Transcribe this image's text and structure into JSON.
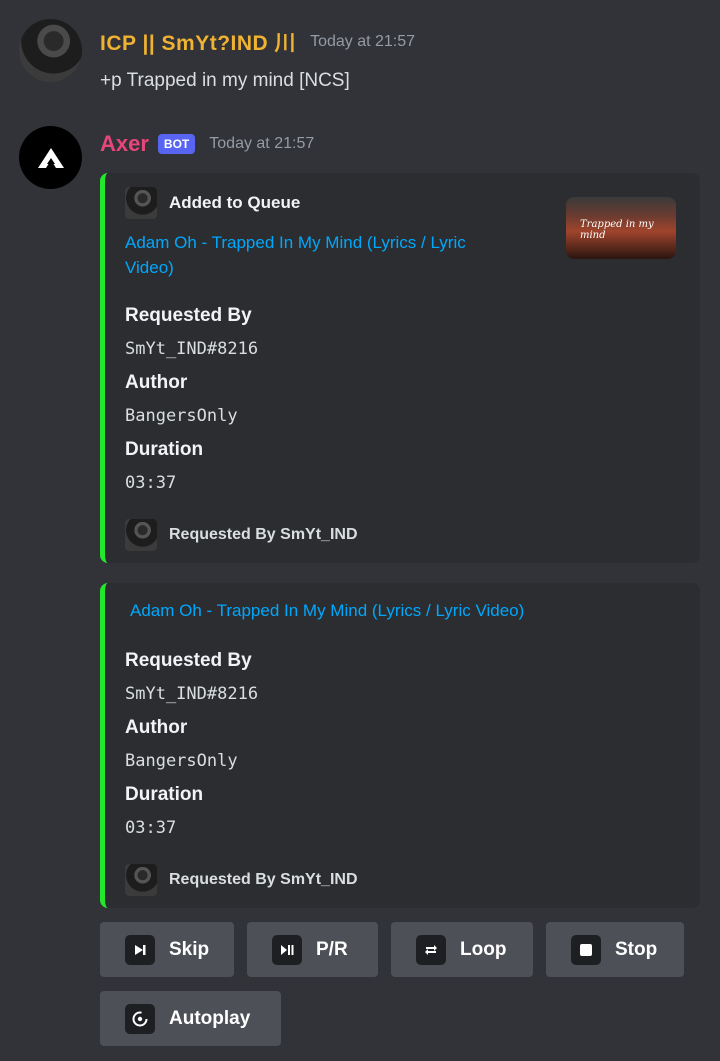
{
  "messages": [
    {
      "username": "ICP || SmYt?IND 川",
      "timestamp": "Today at 21:57",
      "text": "+p Trapped in my mind [NCS]"
    },
    {
      "username": "Axer",
      "badge": "BOT",
      "timestamp": "Today at 21:57"
    }
  ],
  "embeds": [
    {
      "author": "Added to Queue",
      "title": "Adam Oh - Trapped In My Mind (Lyrics / Lyric Video)",
      "thumbnail_text": "Trapped in my mind",
      "fields": [
        {
          "name": "Requested By",
          "value": "SmYt_IND#8216"
        },
        {
          "name": "Author",
          "value": "BangersOnly"
        },
        {
          "name": "Duration",
          "value": "03:37"
        }
      ],
      "footer": "Requested By SmYt_IND",
      "accent": "#23e72a"
    },
    {
      "title": "Adam Oh - Trapped In My Mind (Lyrics / Lyric Video)",
      "fields": [
        {
          "name": "Requested By",
          "value": "SmYt_IND#8216"
        },
        {
          "name": "Author",
          "value": "BangersOnly"
        },
        {
          "name": "Duration",
          "value": "03:37"
        }
      ],
      "footer": "Requested By SmYt_IND",
      "accent": "#23e72a"
    }
  ],
  "buttons": [
    {
      "label": "Skip",
      "icon": "skip-next-icon"
    },
    {
      "label": "P/R",
      "icon": "play-pause-icon"
    },
    {
      "label": "Loop",
      "icon": "loop-icon"
    },
    {
      "label": "Stop",
      "icon": "stop-icon"
    },
    {
      "label": "Autoplay",
      "icon": "autoplay-icon"
    }
  ]
}
